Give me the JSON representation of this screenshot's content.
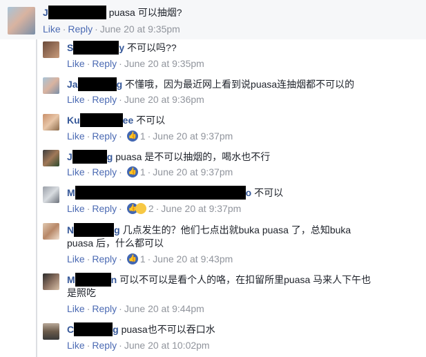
{
  "main_comment": {
    "name_start": "J",
    "text": "puasa 可以抽烟?",
    "actions": {
      "like": "Like",
      "reply": "Reply",
      "time": "June 20 at 9:35pm"
    }
  },
  "replies": [
    {
      "name_start": "S",
      "name_end": "y",
      "text": "不可以吗??",
      "like": "Like",
      "reply": "Reply",
      "time": "June 20 at 9:35pm"
    },
    {
      "name_start": "Ja",
      "name_end": "g",
      "text": "不懂哦，因为最近网上看到说puasa连抽烟都不可以的",
      "like": "Like",
      "reply": "Reply",
      "time": "June 20 at 9:36pm"
    },
    {
      "name_start": "Ku",
      "name_end": "ee",
      "text": "不可以",
      "like": "Like",
      "reply": "Reply",
      "reactions": "1",
      "time": "June 20 at 9:37pm"
    },
    {
      "name_start": "J",
      "name_end": "g",
      "text": "puasa 是不可以抽烟的，喝水也不行",
      "like": "Like",
      "reply": "Reply",
      "reactions": "1",
      "time": "June 20 at 9:37pm"
    },
    {
      "name_start": "M",
      "name_end": "o",
      "text": "不可以",
      "like": "Like",
      "reply": "Reply",
      "reactions": "2",
      "time": "June 20 at 9:37pm"
    },
    {
      "name_start": "N",
      "name_end": "g",
      "text_line1": "几点发生的？他们七点出就buka puasa 了，总知buka",
      "text_line2": "puasa 后，什么都可以",
      "like": "Like",
      "reply": "Reply",
      "reactions": "1",
      "time": "June 20 at 9:43pm"
    },
    {
      "name_start": "M",
      "name_end": "n",
      "text_line1": "可以不可以是看个人的咯，在扣留所里puasa 马来人下午也",
      "text_line2": "是照吃",
      "like": "Like",
      "reply": "Reply",
      "time": "June 20 at 9:44pm"
    },
    {
      "name_start": "C",
      "name_end": "g",
      "text": "puasa也不可以吞口水",
      "like": "Like",
      "reply": "Reply",
      "time": "June 20 at 10:02pm"
    }
  ]
}
